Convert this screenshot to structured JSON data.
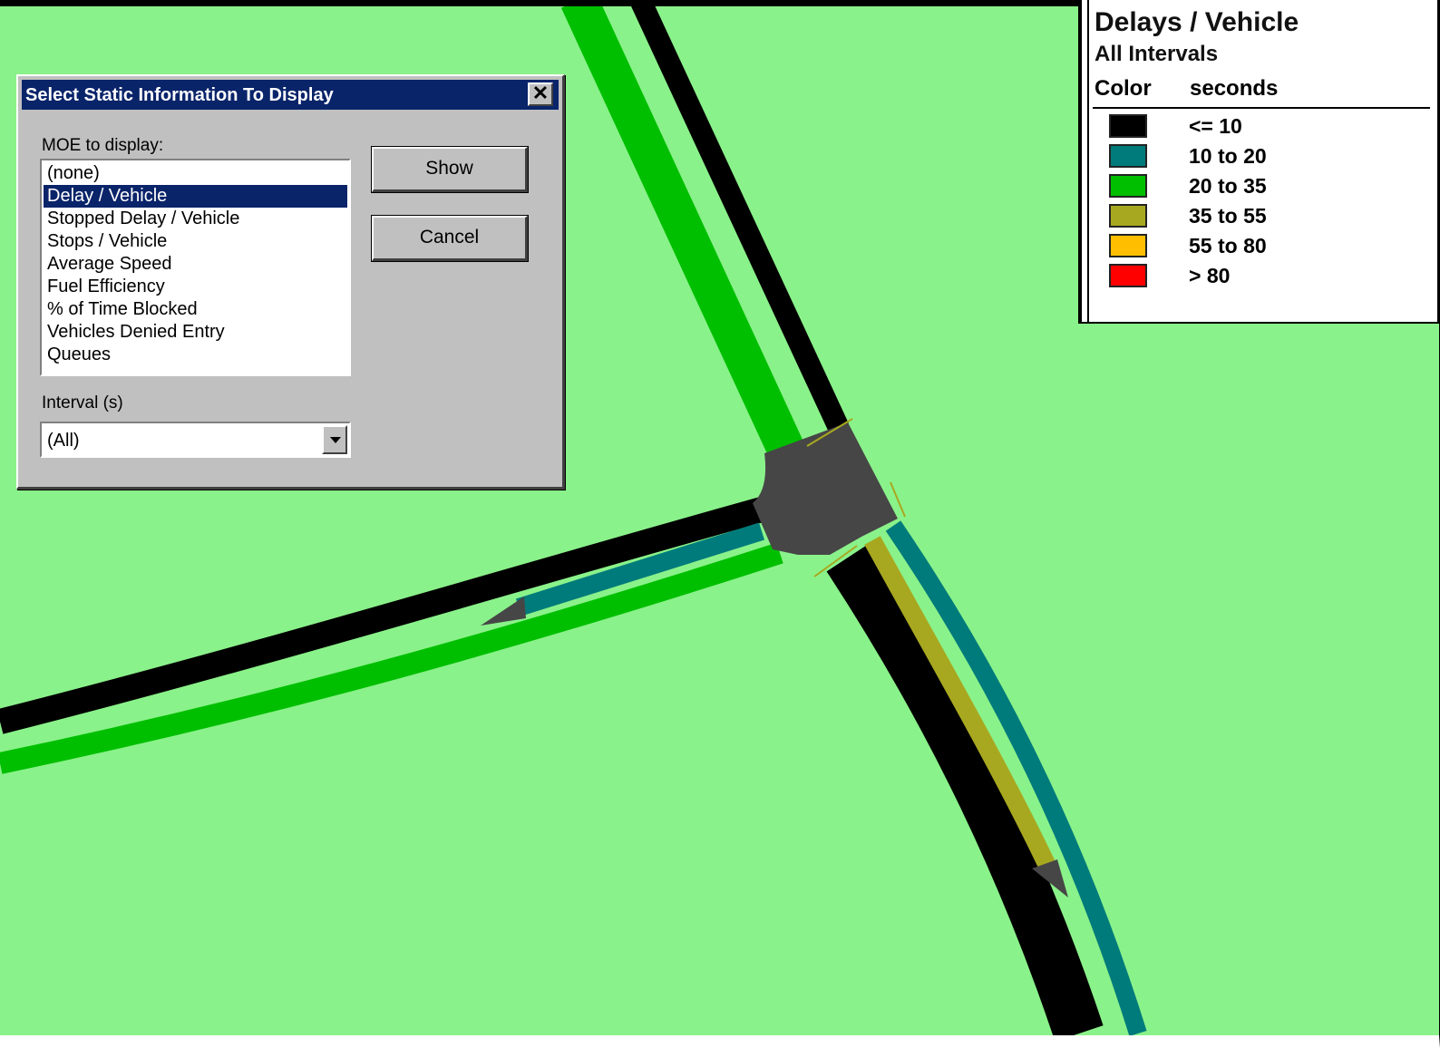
{
  "dialog": {
    "title": "Select Static Information To Display",
    "close_glyph": "✕",
    "moe_label": "MOE to display:",
    "moe_options": [
      "(none)",
      "Delay / Vehicle",
      "Stopped Delay / Vehicle",
      "Stops / Vehicle",
      "Average Speed",
      "Fuel Efficiency",
      "% of Time Blocked",
      "Vehicles Denied Entry",
      "Queues"
    ],
    "moe_selected": "Delay / Vehicle",
    "show_button": "Show",
    "cancel_button": "Cancel",
    "interval_label": "Interval (s)",
    "interval_value": "(All)"
  },
  "legend": {
    "title": "Delays / Vehicle",
    "subtitle": "All Intervals",
    "col_color": "Color",
    "col_unit": "seconds",
    "entries": [
      {
        "label": "<= 10",
        "color": "#000000"
      },
      {
        "label": "10 to 20",
        "color": "#007b7b"
      },
      {
        "label": "20 to 35",
        "color": "#00bf00"
      },
      {
        "label": "35 to 55",
        "color": "#a8a820"
      },
      {
        "label": "55 to 80",
        "color": "#ffbf00"
      },
      {
        "label": "> 80",
        "color": "#ff0000"
      }
    ]
  },
  "map": {
    "background_color": "#8af28a",
    "intersection_color": "#464646"
  }
}
